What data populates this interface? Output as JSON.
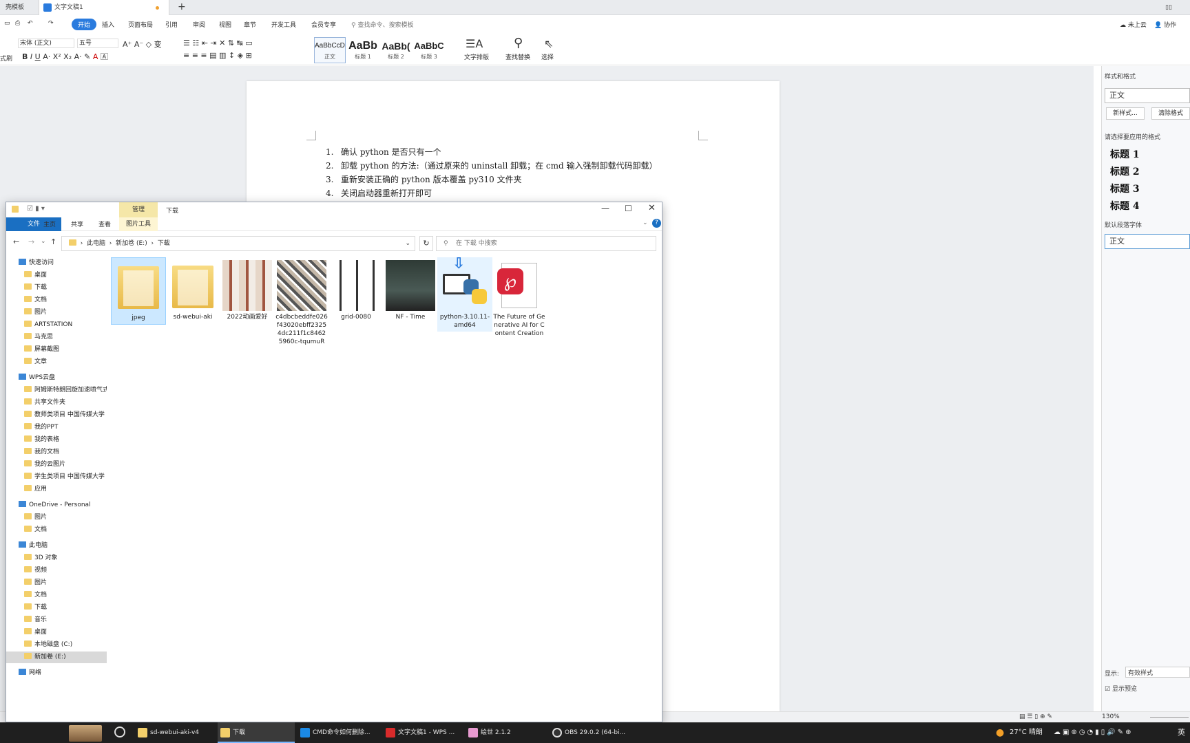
{
  "wps": {
    "tabs": [
      "壳模板",
      "文字文稿1"
    ],
    "menu": [
      "开始",
      "插入",
      "页面布局",
      "引用",
      "审阅",
      "视图",
      "章节",
      "开发工具",
      "会员专享"
    ],
    "search_placeholder": "查找命令、搜索模板",
    "top_right": [
      "未上云",
      "协作"
    ],
    "font_name": "宋体 (正文)",
    "font_size": "五号",
    "styles": [
      {
        "preview": "AaBbCcDd",
        "label": "正文"
      },
      {
        "preview": "AaBb",
        "label": "标题 1"
      },
      {
        "preview": "AaBb(",
        "label": "标题 2"
      },
      {
        "preview": "AaBbC",
        "label": "标题 3"
      }
    ],
    "ribbon_tools": [
      "文字排版",
      "查找替换",
      "选择"
    ],
    "clipboard_label": "式刷"
  },
  "document": {
    "lines": [
      {
        "num": "1.",
        "text": "确认 python 是否只有一个"
      },
      {
        "num": "2.",
        "text": "卸载 python 的方法:（通过原来的 uninstall 卸载；在 cmd 输入强制卸载代码卸载）"
      },
      {
        "num": "3.",
        "text": "重新安装正确的 python 版本覆盖 py310 文件夹"
      },
      {
        "num": "4.",
        "text": "关闭启动器重新打开即可"
      }
    ]
  },
  "style_pane": {
    "title": "样式和格式",
    "current": "正文",
    "new_style": "新样式...",
    "clear_format": "清除格式",
    "choose_label": "请选择要应用的格式",
    "headings": [
      "标题 1",
      "标题 2",
      "标题 3",
      "标题 4"
    ],
    "default_font": "默认段落字体",
    "body": "正文",
    "show_label": "显示:",
    "show_value": "有效样式",
    "preview_label": "显示预览"
  },
  "statusbar": {
    "zoom": "130%"
  },
  "explorer": {
    "title": "下载",
    "manage_tab": "管理",
    "picture_tools": "图片工具",
    "tabs": [
      "文件",
      "主页",
      "共享",
      "查看"
    ],
    "address": [
      "此电脑",
      "新加卷 (E:)",
      "下载"
    ],
    "search_placeholder": "在 下载 中搜索",
    "nav": [
      {
        "label": "快速访问",
        "level": 0
      },
      {
        "label": "桌面",
        "level": 1
      },
      {
        "label": "下载",
        "level": 1
      },
      {
        "label": "文档",
        "level": 1
      },
      {
        "label": "图片",
        "level": 1
      },
      {
        "label": "ARTSTATION",
        "level": 1
      },
      {
        "label": "马克思",
        "level": 1
      },
      {
        "label": "屏幕截图",
        "level": 1
      },
      {
        "label": "文章",
        "level": 1
      },
      {
        "label": "WPS云盘",
        "level": 0
      },
      {
        "label": "阿姆斯特朗回旋加速喷气式",
        "level": 1
      },
      {
        "label": "共享文件夹",
        "level": 1
      },
      {
        "label": "教师类项目 中国传媒大学",
        "level": 1
      },
      {
        "label": "我的PPT",
        "level": 1
      },
      {
        "label": "我的表格",
        "level": 1
      },
      {
        "label": "我的文档",
        "level": 1
      },
      {
        "label": "我的云图片",
        "level": 1
      },
      {
        "label": "学生类项目 中国传媒大学",
        "level": 1
      },
      {
        "label": "应用",
        "level": 1
      },
      {
        "label": "OneDrive - Personal",
        "level": 0
      },
      {
        "label": "图片",
        "level": 1
      },
      {
        "label": "文档",
        "level": 1
      },
      {
        "label": "此电脑",
        "level": 0
      },
      {
        "label": "3D 对象",
        "level": 1
      },
      {
        "label": "视频",
        "level": 1
      },
      {
        "label": "图片",
        "level": 1
      },
      {
        "label": "文档",
        "level": 1
      },
      {
        "label": "下载",
        "level": 1
      },
      {
        "label": "音乐",
        "level": 1
      },
      {
        "label": "桌面",
        "level": 1
      },
      {
        "label": "本地磁盘 (C:)",
        "level": 1
      },
      {
        "label": "新加卷 (E:)",
        "level": 1
      },
      {
        "label": "网络",
        "level": 0
      }
    ],
    "files": [
      {
        "name": "jpeg",
        "kind": "folder"
      },
      {
        "name": "sd-webui-aki",
        "kind": "folder"
      },
      {
        "name": "2022动画爱好",
        "kind": "image"
      },
      {
        "name": "c4dbcbeddfe026f43020ebff23254dc211f1c84625960c-tqumuR",
        "kind": "image"
      },
      {
        "name": "grid-0080",
        "kind": "image"
      },
      {
        "name": "NF - Time",
        "kind": "image"
      },
      {
        "name": "python-3.10.11-amd64",
        "kind": "installer"
      },
      {
        "name": "The Future of Generative AI for Content Creation",
        "kind": "pdf"
      }
    ]
  },
  "taskbar": {
    "items": [
      "sd-webui-aki-v4",
      "下载",
      "CMD命令如何删除...",
      "文字文稿1 - WPS ...",
      "绘世 2.1.2",
      "OBS 29.0.2 (64-bi..."
    ],
    "weather": "27°C 晴朗",
    "ime": "英"
  }
}
